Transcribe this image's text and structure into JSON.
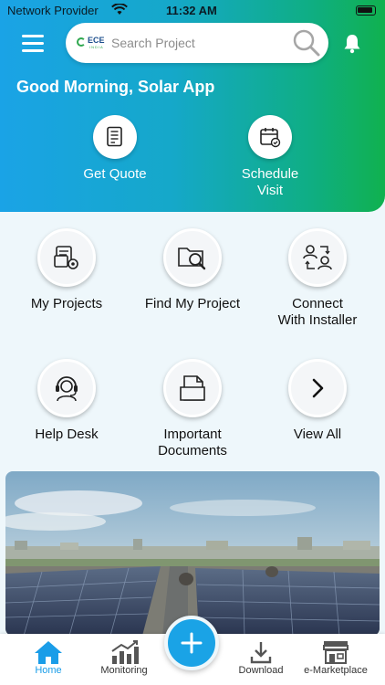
{
  "status_bar": {
    "provider": "Network Provider",
    "time": "11:32 AM"
  },
  "header": {
    "logo_text": "ECE",
    "logo_subtext": "INDIA",
    "search_placeholder": "Search Project",
    "greeting": "Good Morning, Solar App"
  },
  "quick_actions": [
    {
      "label": "Get Quote",
      "icon": "document-icon"
    },
    {
      "label_line1": "Schedule",
      "label_line2": "Visit",
      "icon": "calendar-icon"
    }
  ],
  "services": [
    {
      "label": "My Projects",
      "icon": "project-settings-icon"
    },
    {
      "label": "Find My Project",
      "icon": "folder-search-icon"
    },
    {
      "label_line1": "Connect",
      "label_line2": "With Installer",
      "icon": "users-connect-icon"
    },
    {
      "label": "Help Desk",
      "icon": "headset-icon"
    },
    {
      "label_line1": "Important",
      "label_line2": "Documents",
      "icon": "documents-icon"
    },
    {
      "label": "View All",
      "icon": "chevron-right-icon"
    }
  ],
  "bottom_nav": [
    {
      "label": "Home",
      "icon": "home-icon",
      "active": true
    },
    {
      "label": "Monitoring",
      "icon": "chart-icon",
      "active": false
    },
    {
      "label": "Download",
      "icon": "download-icon",
      "active": false
    },
    {
      "label": "e-Marketplace",
      "icon": "store-icon",
      "active": false
    }
  ],
  "colors": {
    "gradient_start": "#1aa3e6",
    "gradient_end": "#10b14f",
    "accent": "#1aa3e6",
    "background": "#eef7fb"
  }
}
